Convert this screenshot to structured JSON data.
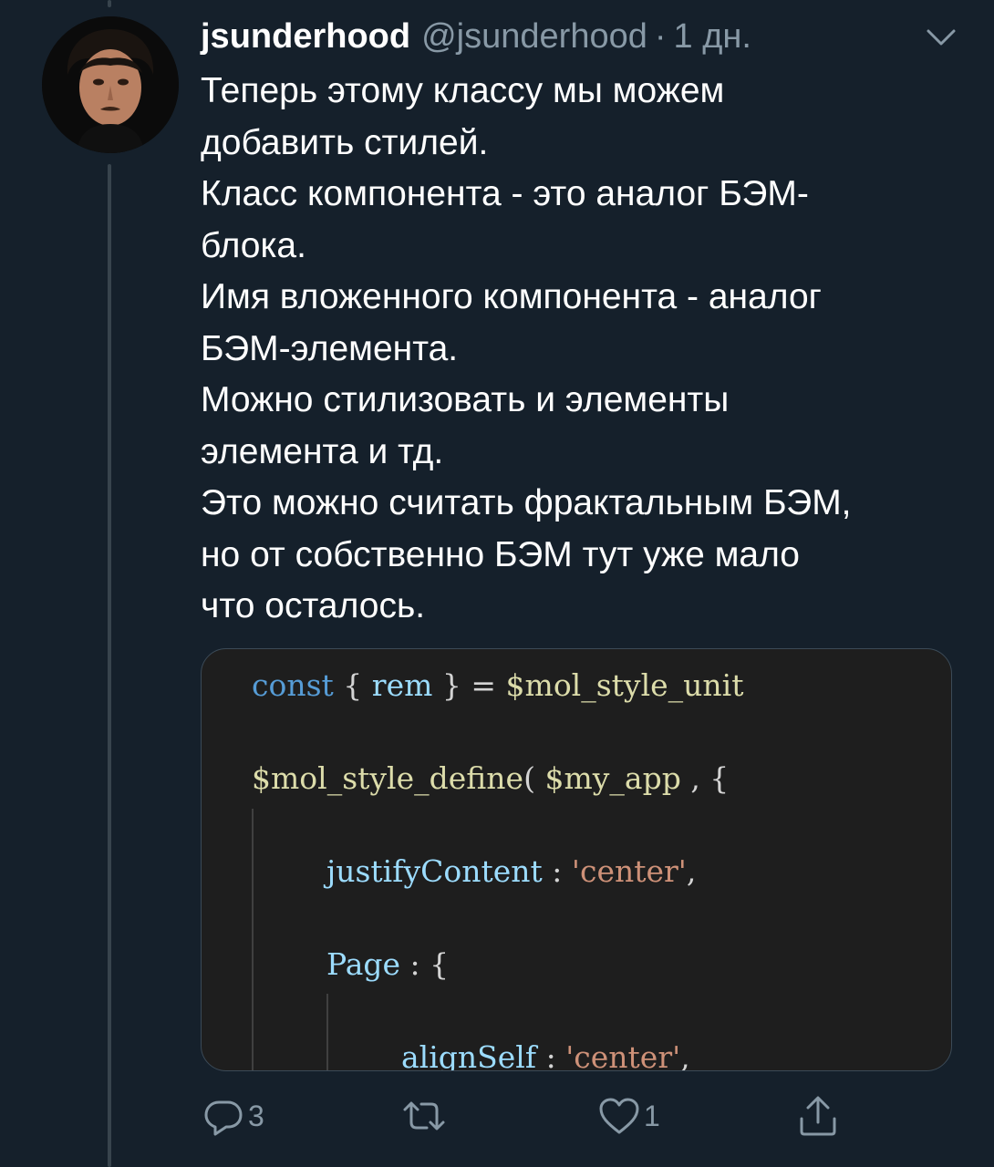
{
  "tweet": {
    "display_name": "jsunderhood",
    "handle": "@jsunderhood",
    "separator": "·",
    "time": "1 дн.",
    "text_lines": [
      "Теперь этому классу мы можем",
      "добавить стилей.",
      "Класс компонента - это аналог БЭМ-",
      "блока.",
      "Имя вложенного компонента - аналог",
      "БЭМ-элемента.",
      "Можно стилизовать и элементы",
      "элемента и тд.",
      "Это можно считать фрактальным БЭМ,",
      "но от собственно БЭМ тут уже мало",
      "что осталось."
    ]
  },
  "code": {
    "line1": {
      "kw": "const",
      "p1": " { ",
      "var": "rem",
      "p2": " } = ",
      "fn": "$mol_style_unit"
    },
    "line2": {
      "fn1": "$mol_style_define",
      "p1": "( ",
      "fn2": "$my_app",
      "p2": " , {"
    },
    "line3": {
      "var": "justifyContent",
      "p1": " : ",
      "str": "'center'",
      "p2": ","
    },
    "line4": {
      "var": "Page",
      "p1": " : {"
    },
    "line5": {
      "var": "alignSelf",
      "p1": " : ",
      "str": "'center'",
      "p2": ","
    }
  },
  "actions": {
    "reply_count": "3",
    "retweet_count": "",
    "like_count": "1"
  },
  "icons": {
    "avatar": "avatar-photo",
    "caret": "chevron-down-icon",
    "reply": "reply-icon",
    "retweet": "retweet-icon",
    "like": "heart-icon",
    "share": "share-icon"
  },
  "colors": {
    "background": "#15202b",
    "text": "#ffffff",
    "secondary": "#8899a6",
    "code_bg": "#1e1e1e"
  }
}
